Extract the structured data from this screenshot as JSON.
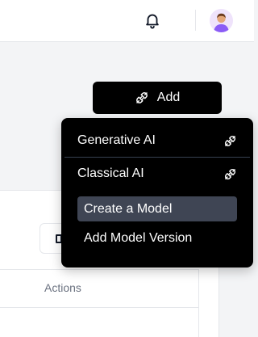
{
  "header": {
    "notifications_icon": "bell-icon",
    "avatar_icon": "user-avatar"
  },
  "toolbar": {
    "add_label": "Add",
    "add_icon": "plug-icon"
  },
  "add_menu": {
    "groups": [
      {
        "label": "Generative AI",
        "icon": "plug-icon"
      },
      {
        "label": "Classical AI",
        "icon": "plug-icon"
      }
    ],
    "items": [
      {
        "label": "Create a Model",
        "active": true
      },
      {
        "label": "Add Model Version",
        "active": false
      }
    ]
  },
  "table": {
    "columns": [
      "Actions"
    ]
  },
  "colors": {
    "menu_bg": "#000000",
    "active_item_bg": "#3f4554",
    "page_bg": "#f3f4f6"
  }
}
